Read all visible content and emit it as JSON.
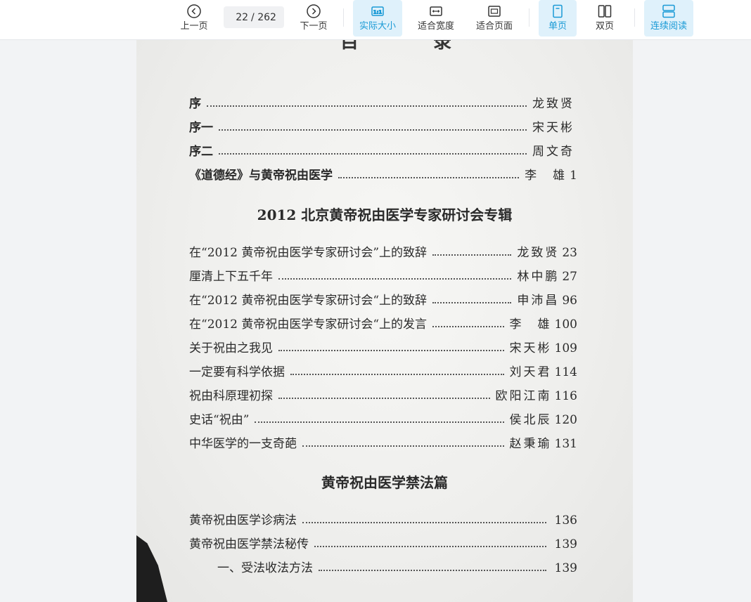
{
  "toolbar": {
    "prev_label": "上一页",
    "next_label": "下一页",
    "current_page": "22",
    "total_pages": "/ 262",
    "actual_size_label": "实际大小",
    "fit_width_label": "适合宽度",
    "fit_page_label": "适合页面",
    "single_page_label": "单页",
    "double_page_label": "双页",
    "continuous_label": "连续阅读",
    "accent_color": "#1a9ad6"
  },
  "document": {
    "title": "目　录",
    "intro_entries": [
      {
        "title": "序",
        "author": "龙致贤",
        "page": ""
      },
      {
        "title": "序一",
        "author": "宋天彬",
        "page": ""
      },
      {
        "title": "序二",
        "author": "周文奇",
        "page": ""
      },
      {
        "title": "《道德经》与黄帝祝由医学",
        "author": "李　雄",
        "page": "1"
      }
    ],
    "section1_heading": "2012 北京黄帝祝由医学专家研讨会专辑",
    "section1_entries": [
      {
        "title": "在“2012 黄帝祝由医学专家研讨会”上的致辞",
        "author": "龙致贤",
        "page": "23"
      },
      {
        "title": "厘清上下五千年",
        "author": "林中鹏",
        "page": "27"
      },
      {
        "title": "在“2012 黄帝祝由医学专家研讨会“上的致辞",
        "author": "申沛昌",
        "page": "96"
      },
      {
        "title": "在“2012 黄帝祝由医学专家研讨会“上的发言",
        "author": "李　雄",
        "page": "100"
      },
      {
        "title": "关于祝由之我见",
        "author": "宋天彬",
        "page": "109"
      },
      {
        "title": "一定要有科学依据",
        "author": "刘天君",
        "page": "114"
      },
      {
        "title": "祝由科原理初探",
        "author": "欧阳江南",
        "page": "116"
      },
      {
        "title": "史话“祝由”",
        "author": "侯北辰",
        "page": "120"
      },
      {
        "title": "中华医学的一支奇葩",
        "author": "赵秉瑜",
        "page": "131"
      }
    ],
    "section2_heading": "黄帝祝由医学禁法篇",
    "section2_entries": [
      {
        "title": "黄帝祝由医学诊病法",
        "author": "",
        "page": "136"
      },
      {
        "title": "黄帝祝由医学禁法秘传",
        "author": "",
        "page": "139"
      },
      {
        "title": "一、受法收法方法",
        "author": "",
        "page": "139"
      }
    ]
  }
}
